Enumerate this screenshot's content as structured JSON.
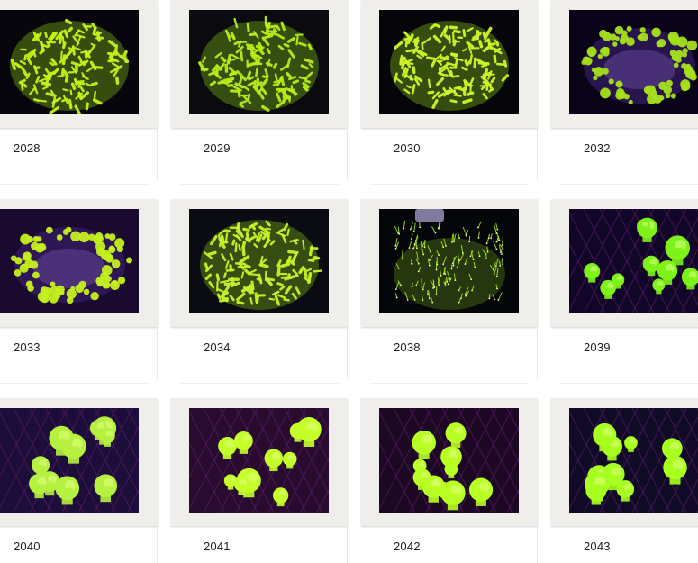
{
  "items": [
    {
      "label": "2028",
      "variant": "polyp",
      "bg": "#07060d",
      "accent": "#c6f21a"
    },
    {
      "label": "2029",
      "variant": "polyp",
      "bg": "#0a0a0f",
      "accent": "#b8ec1a"
    },
    {
      "label": "2030",
      "variant": "polyp",
      "bg": "#05050a",
      "accent": "#cff52a"
    },
    {
      "label": "2032",
      "variant": "ring",
      "bg": "#0a0418",
      "accent": "#a6e01a"
    },
    {
      "label": "2033",
      "variant": "ring",
      "bg": "#1a0a30",
      "accent": "#c4f01e"
    },
    {
      "label": "2034",
      "variant": "polyp",
      "bg": "#0b0b14",
      "accent": "#c8f22a"
    },
    {
      "label": "2038",
      "variant": "spark",
      "bg": "#04060a",
      "accent": "#9ee814"
    },
    {
      "label": "2039",
      "variant": "blob",
      "bg": "#120628",
      "accent": "#7cf21a"
    },
    {
      "label": "2040",
      "variant": "blob",
      "bg": "#1c0d3a",
      "accent": "#b6f040"
    },
    {
      "label": "2041",
      "variant": "blob",
      "bg": "#2a0b30",
      "accent": "#c4ff2a"
    },
    {
      "label": "2042",
      "variant": "blob",
      "bg": "#1c0822",
      "accent": "#b8ff24"
    },
    {
      "label": "2043",
      "variant": "blob",
      "bg": "#100a26",
      "accent": "#a6ff1e"
    }
  ]
}
